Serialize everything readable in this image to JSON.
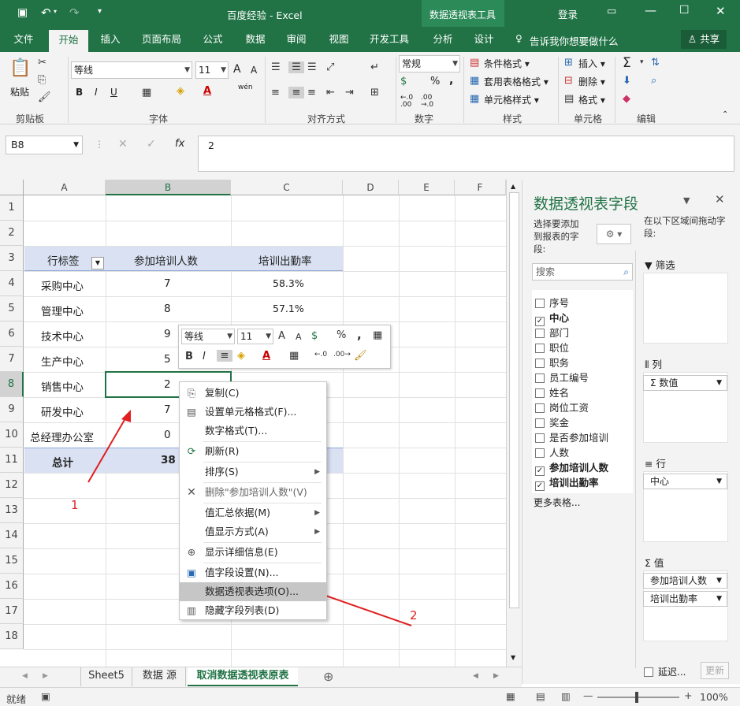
{
  "title": {
    "document": "百度经验",
    "app": "Excel",
    "context_tab": "数据透视表工具",
    "login": "登录"
  },
  "tabs": [
    "文件",
    "开始",
    "插入",
    "页面布局",
    "公式",
    "数据",
    "审阅",
    "视图",
    "开发工具",
    "分析",
    "设计"
  ],
  "tell_me": "告诉我你想要做什么",
  "share": "共享",
  "ribbon": {
    "paste": "粘贴",
    "groups": {
      "clipboard": "剪贴板",
      "font": "字体",
      "align": "对齐方式",
      "number": "数字",
      "styles": "样式",
      "cells": "单元格",
      "edit": "编辑"
    },
    "font_name": "等线",
    "font_size": "11",
    "wen": "wén",
    "bold": "B",
    "italic": "I",
    "underline": "U",
    "grow": "A",
    "shrink": "A",
    "number_format": "常规",
    "percent": "%",
    "comma": ",",
    "dec_inc": "←.0 .00",
    "dec_dec": ".00 →.0",
    "cond_format": "条件格式",
    "table_format": "套用表格格式",
    "cell_style": "单元格样式",
    "insert": "插入",
    "delete": "删除",
    "format": "格式",
    "sigma": "Σ"
  },
  "formula_bar": {
    "name_box": "B8",
    "value": "2",
    "fx": "fx"
  },
  "grid": {
    "columns": [
      "A",
      "B",
      "C",
      "D",
      "E",
      "F"
    ],
    "rows": [
      "1",
      "2",
      "3",
      "4",
      "5",
      "6",
      "7",
      "8",
      "9",
      "10",
      "11",
      "12",
      "13",
      "14",
      "15",
      "16",
      "17",
      "18"
    ],
    "header": {
      "row_label": "行标签",
      "count": "参加培训人数",
      "rate": "培训出勤率"
    },
    "data": [
      {
        "name": "采购中心",
        "count": "7",
        "rate": "58.3%"
      },
      {
        "name": "管理中心",
        "count": "8",
        "rate": "57.1%"
      },
      {
        "name": "技术中心",
        "count": "9",
        "rate": ""
      },
      {
        "name": "生产中心",
        "count": "5",
        "rate": ""
      },
      {
        "name": "销售中心",
        "count": "2",
        "rate": ""
      },
      {
        "name": "研发中心",
        "count": "7",
        "rate": ""
      },
      {
        "name": "总经理办公室",
        "count": "0",
        "rate": ""
      }
    ],
    "total": {
      "name": "总计",
      "count": "38"
    }
  },
  "mini_toolbar": {
    "font": "等线",
    "size": "11",
    "percent": "%",
    "comma": ","
  },
  "context_menu": [
    {
      "label": "复制(C)",
      "icon": "copy-icon",
      "sub": false
    },
    {
      "label": "设置单元格格式(F)...",
      "icon": "format-cells-icon",
      "sub": false
    },
    {
      "label": "数字格式(T)...",
      "icon": "",
      "sub": false
    },
    {
      "label": "刷新(R)",
      "icon": "refresh-icon",
      "sub": false
    },
    {
      "label": "排序(S)",
      "icon": "",
      "sub": true
    },
    {
      "label": "删除\"参加培训人数\"(V)",
      "icon": "delete-x-icon",
      "sub": false
    },
    {
      "label": "值汇总依据(M)",
      "icon": "",
      "sub": true
    },
    {
      "label": "值显示方式(A)",
      "icon": "",
      "sub": true
    },
    {
      "label": "显示详细信息(E)",
      "icon": "show-detail-icon",
      "sub": false
    },
    {
      "label": "值字段设置(N)...",
      "icon": "field-settings-icon",
      "sub": false
    },
    {
      "label": "数据透视表选项(O)...",
      "icon": "",
      "sub": false,
      "highlighted": true
    },
    {
      "label": "隐藏字段列表(D)",
      "icon": "field-list-icon",
      "sub": false
    }
  ],
  "pivot_pane": {
    "title": "数据透视表字段",
    "choose": "选择要添加到报表的字段:",
    "drag": "在以下区域间拖动字段:",
    "search_placeholder": "搜索",
    "fields": [
      {
        "name": "序号",
        "checked": false
      },
      {
        "name": "中心",
        "checked": true
      },
      {
        "name": "部门",
        "checked": false
      },
      {
        "name": "职位",
        "checked": false
      },
      {
        "name": "职务",
        "checked": false
      },
      {
        "name": "员工编号",
        "checked": false
      },
      {
        "name": "姓名",
        "checked": false
      },
      {
        "name": "岗位工资",
        "checked": false
      },
      {
        "name": "奖金",
        "checked": false
      },
      {
        "name": "是否参加培训",
        "checked": false
      },
      {
        "name": "人数",
        "checked": false
      },
      {
        "name": "参加培训人数",
        "checked": true
      },
      {
        "name": "培训出勤率",
        "checked": true
      }
    ],
    "more": "更多表格...",
    "filter": "筛选",
    "columns": "列",
    "rows": "行",
    "values": "值",
    "col_item": "Σ 数值",
    "row_item": "中心",
    "value_items": [
      "参加培训人数",
      "培训出勤率"
    ],
    "defer": "延迟...",
    "update": "更新"
  },
  "sheets": [
    "Sheet5",
    "数据 源",
    "取消数据透视表原表"
  ],
  "status": {
    "ready": "就绪",
    "zoom": "100%"
  },
  "annotations": [
    "1",
    "2"
  ],
  "colors": {
    "excel_green": "#217346",
    "pivot_header": "#d9e1f2",
    "highlight": "#c6c6c6",
    "arrow": "#e02020"
  }
}
